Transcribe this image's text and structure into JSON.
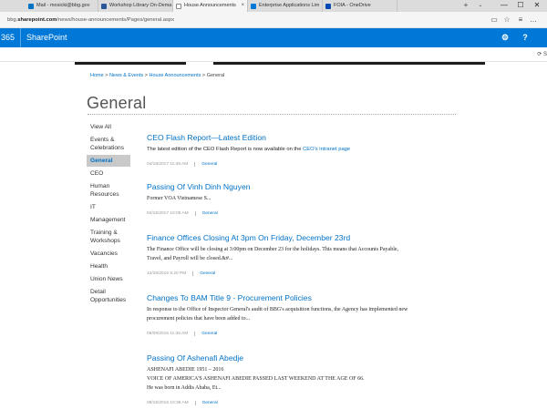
{
  "browser": {
    "tabs": [
      {
        "label": "Mail - mosicki@bbg.gov",
        "active": false,
        "icon_color": "#0072c6"
      },
      {
        "label": "Workshop Library On-Dema",
        "active": false,
        "icon_color": "#2b579a"
      },
      {
        "label": "House Announcements",
        "active": true,
        "icon_color": "#ffffff"
      },
      {
        "label": "Enterprise Applications Lim",
        "active": false,
        "icon_color": "#0078d7"
      },
      {
        "label": "FOIA - OneDrive",
        "active": false,
        "icon_color": "#094ab2"
      }
    ],
    "new_tab_glyph": "+",
    "tab_list_glyph": "⌄",
    "close_glyph": "×",
    "window_controls": {
      "minimize": "—",
      "maximize": "☐",
      "close": "✕"
    },
    "url": {
      "host_prefix": "bbg.",
      "host_bold": "sharepoint.com",
      "path": "/news/house-announcements/Pages/general.aspx"
    },
    "address_icons": {
      "reading_view": "▭",
      "favorite": "☆",
      "hub": "≡",
      "notes": "✎",
      "share": "⇪",
      "more": "…"
    }
  },
  "suite": {
    "app_prefix": "365",
    "app_name": "SharePoint",
    "settings_glyph": "⚙",
    "help_glyph": "?",
    "brand_color": "#0078d7"
  },
  "subbar": {
    "share_glyph": "⟳",
    "share_label": "S"
  },
  "breadcrumb": {
    "home": "Home",
    "sep1": " > ",
    "news": "News & Events",
    "sep2": " > ",
    "house": "House Announcements",
    "sep3": " > ",
    "current": "General"
  },
  "page_title": "General",
  "nav": {
    "items": [
      {
        "label": "View All"
      },
      {
        "label": "Events & Celebrations"
      },
      {
        "label": "General"
      },
      {
        "label": "CEO"
      },
      {
        "label": "Human Resources"
      },
      {
        "label": "IT"
      },
      {
        "label": "Management"
      },
      {
        "label": "Training & Workshops"
      },
      {
        "label": "Vacancies"
      },
      {
        "label": "Health"
      },
      {
        "label": "Union News"
      },
      {
        "label": "Detail Opportunities"
      }
    ],
    "selected_index": 2
  },
  "articles": [
    {
      "title": "CEO Flash Report—Latest Edition",
      "body_text": "The latest edition of the CEO Flash Report is now available on the ",
      "body_link": "CEO's intranet page",
      "date": "04/18/2017 11:38 AM",
      "category": "General"
    },
    {
      "title": "Passing Of Vinh Dinh Nguyen",
      "body_lines": [
        "Former VOA Vietnamese S..."
      ],
      "date": "04/15/2017 10:09 AM",
      "category": "General"
    },
    {
      "title": "Finance Offices Closing At 3pm On Friday, December 23rd",
      "body_lines": [
        "The Finance Office will be closing at 3:00pm on December 23 for the holidays.  This means that Accounts Payable,",
        "Travel, and Payroll will be closed.&#..."
      ],
      "date": "12/28/2016 5:20 PM",
      "category": "General"
    },
    {
      "title": "Changes To BAM Title 9 - Procurement Policies",
      "body_lines": [
        "In response to the Office of Inspector General's audit of BBG's acquisition functions, the Agency has implemented new",
        "procurement policies that have been added to..."
      ],
      "date": "09/09/2016 11:36 AM",
      "category": "General"
    },
    {
      "title": "Passing Of Ashenafi Abedje",
      "body_lines": [
        "ASHENAFI ABEDIE 1951 – 2016",
        "VOICE OF AMERICA'S ASHENAFI ABEDIE PASSED LAST WEEKEND AT THE AGE OF 66.",
        "He was born in Addis Ababa, Et..."
      ],
      "date": "08/15/2016 10:36 AM",
      "category": "General"
    }
  ]
}
